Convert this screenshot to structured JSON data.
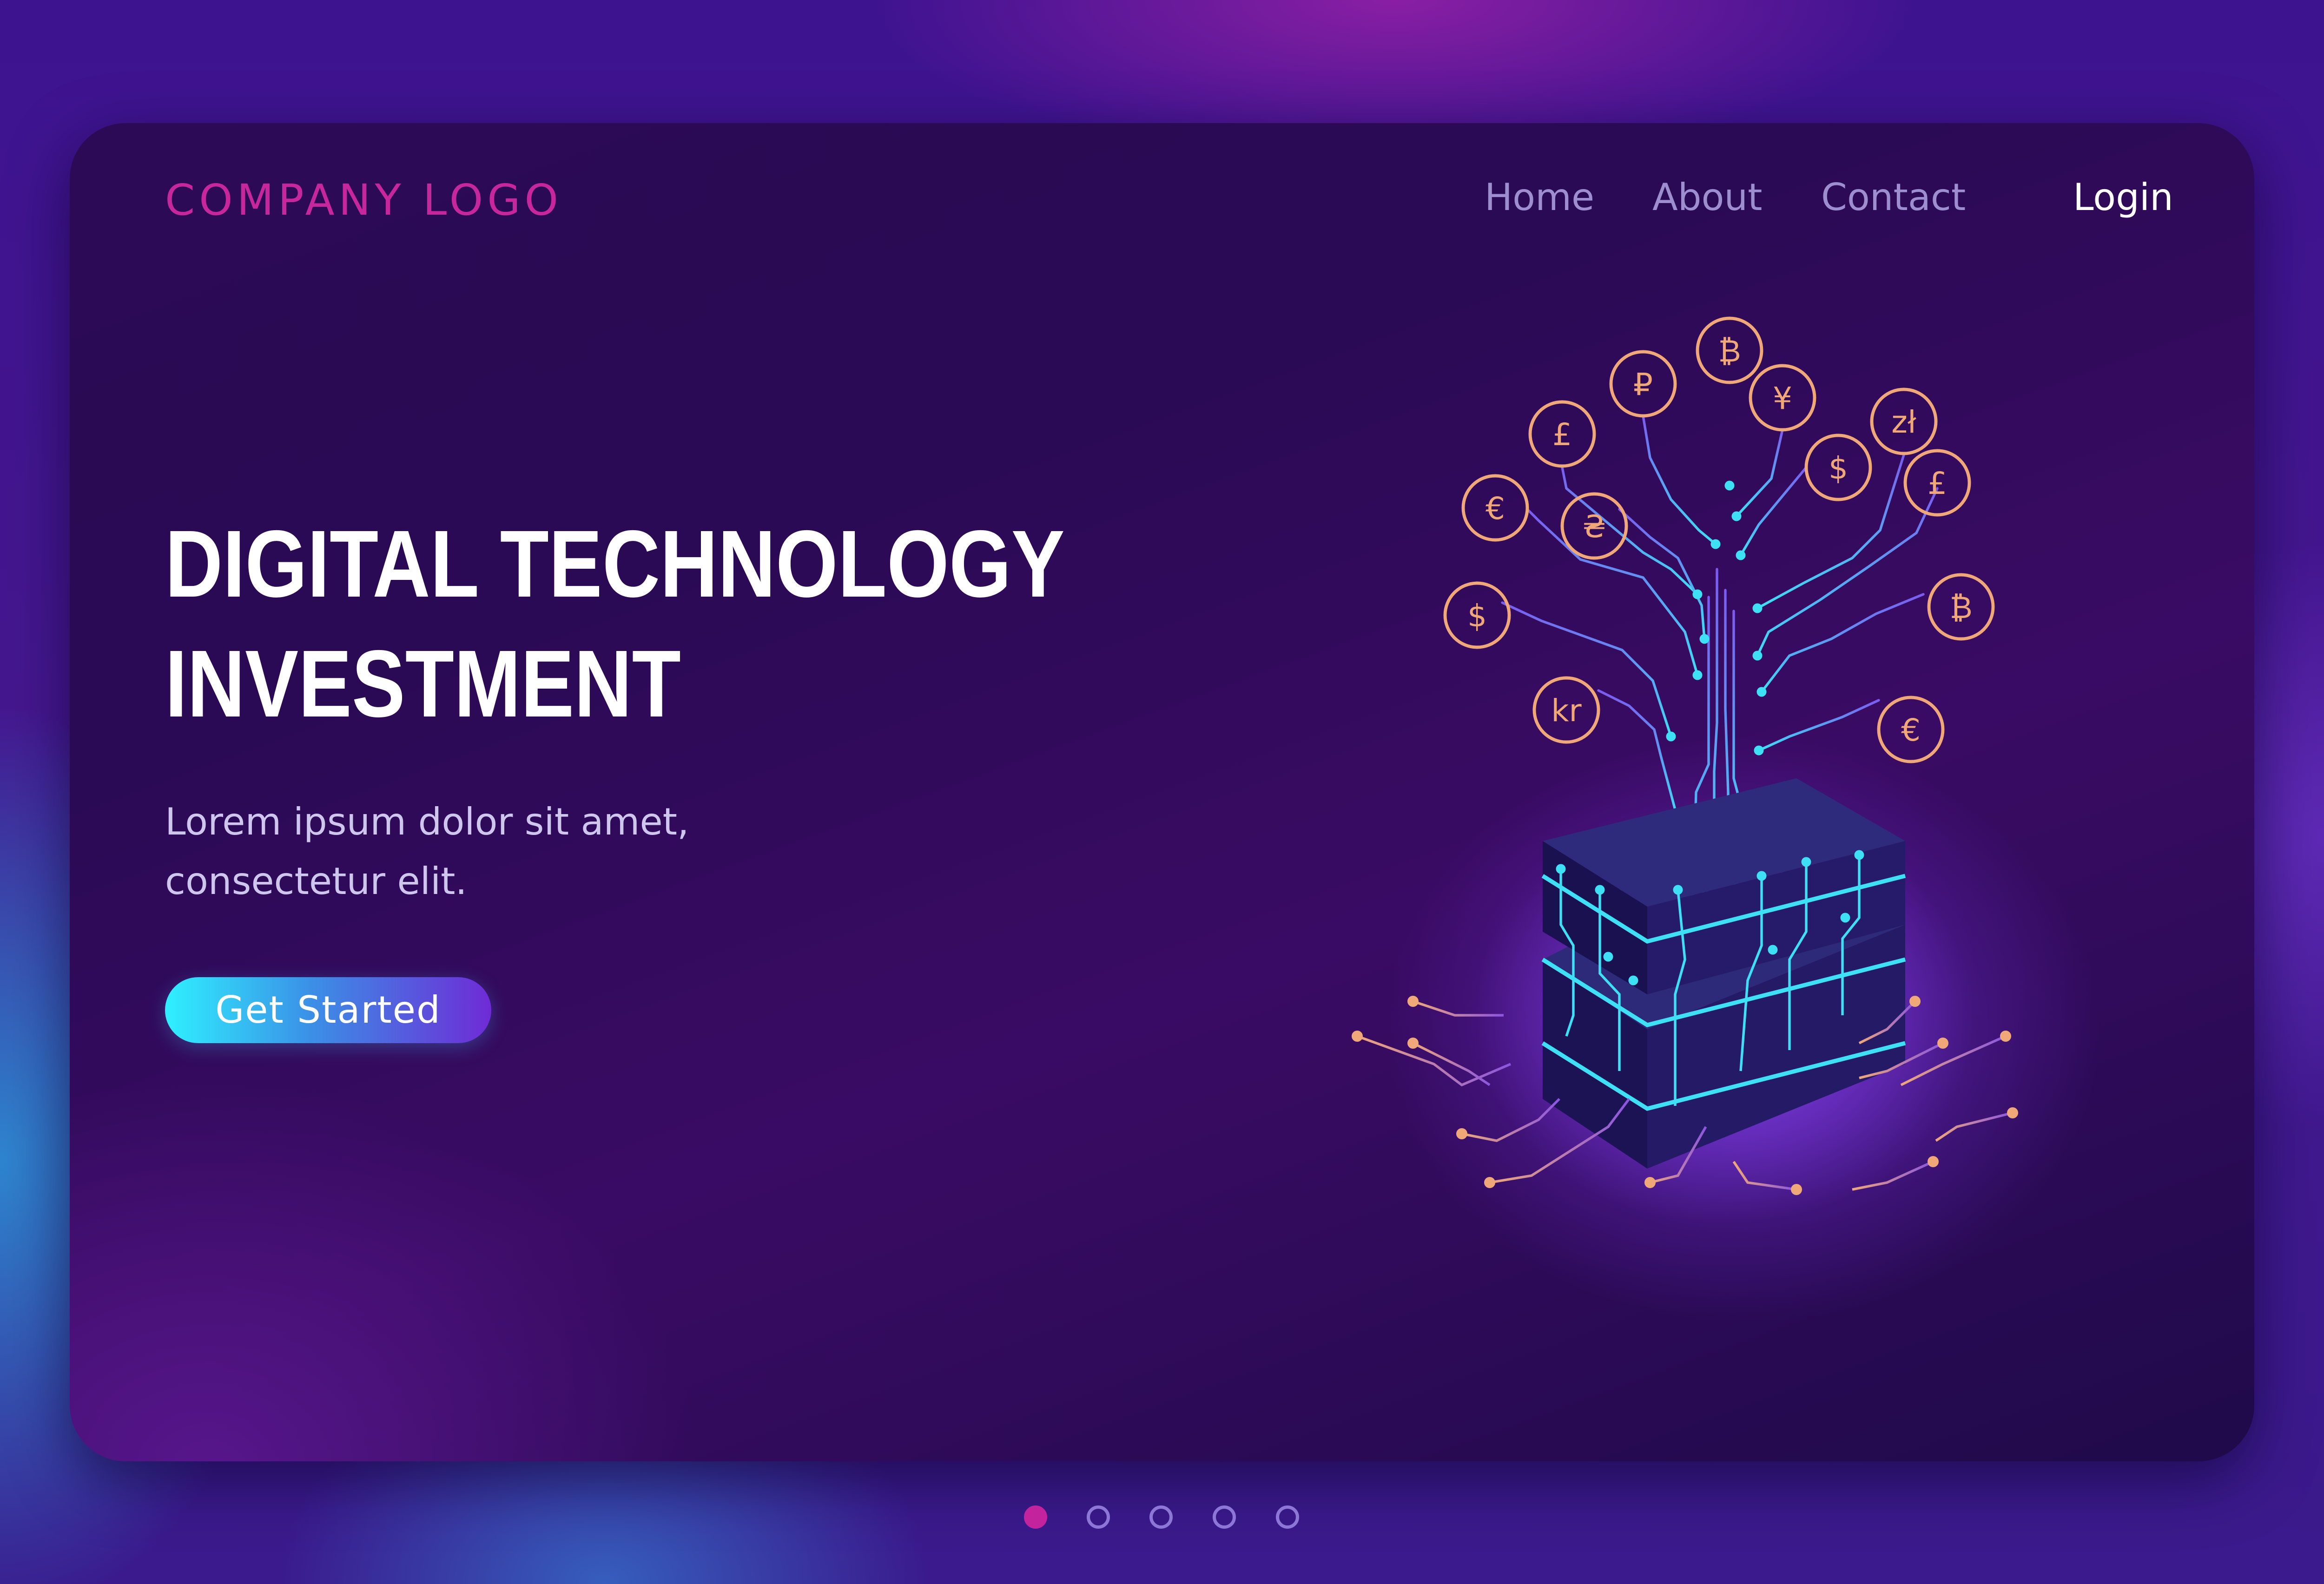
{
  "header": {
    "logo": "COMPANY LOGO",
    "nav": [
      "Home",
      "About",
      "Contact"
    ],
    "login": "Login"
  },
  "hero": {
    "title_line1": "DIGITAL TECHNOLOGY",
    "title_line2": "INVESTMENT",
    "subtitle_line1": "Lorem ipsum dolor sit amet,",
    "subtitle_line2": "consectetur elit.",
    "cta_label": "Get Started"
  },
  "illustration": {
    "currency_symbols": [
      "₿",
      "₽",
      "¥",
      "zł",
      "£",
      "$",
      "£",
      "€",
      "₴",
      "₿",
      "$",
      "kr",
      "€"
    ],
    "colors": {
      "coin": "#f0a878",
      "trace_cyan": "#3ee0f5",
      "trace_purple": "#7a5cf0",
      "chip_top": "#2d2a7a",
      "chip_side": "#1c1355"
    }
  },
  "pagination": {
    "count": 5,
    "active_index": 0
  },
  "colors": {
    "logo": "#c8279c",
    "nav": "#9d8ecf",
    "login": "#ffffff",
    "cta_gradient_start": "#2ff0ff",
    "cta_gradient_end": "#6f2bd6",
    "dot_active": "#c3249e",
    "dot_inactive": "#8c76d6"
  }
}
